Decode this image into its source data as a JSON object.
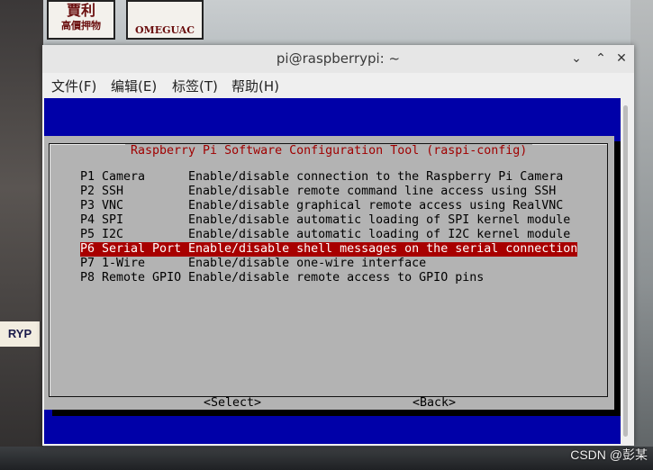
{
  "window": {
    "title": "pi@raspberrypi: ~",
    "controls": {
      "minimize": "⌄",
      "maximize": "⌃",
      "close": "✕"
    }
  },
  "menubar": {
    "items": [
      "文件(F)",
      "编辑(E)",
      "标签(T)",
      "帮助(H)"
    ]
  },
  "dialog": {
    "title": "Raspberry Pi Software Configuration Tool (raspi-config)",
    "selected_index": 5,
    "options": [
      {
        "key": "P1 Camera",
        "desc": "Enable/disable connection to the Raspberry Pi Camera"
      },
      {
        "key": "P2 SSH",
        "desc": "Enable/disable remote command line access using SSH"
      },
      {
        "key": "P3 VNC",
        "desc": "Enable/disable graphical remote access using RealVNC"
      },
      {
        "key": "P4 SPI",
        "desc": "Enable/disable automatic loading of SPI kernel module"
      },
      {
        "key": "P5 I2C",
        "desc": "Enable/disable automatic loading of I2C kernel module"
      },
      {
        "key": "P6 Serial Port",
        "desc": "Enable/disable shell messages on the serial connection"
      },
      {
        "key": "P7 1-Wire",
        "desc": "Enable/disable one-wire interface"
      },
      {
        "key": "P8 Remote GPIO",
        "desc": "Enable/disable remote access to GPIO pins"
      }
    ],
    "buttons": {
      "select": "<Select>",
      "back": "<Back>"
    }
  },
  "background": {
    "sign_1": "賈利",
    "sign_1_sub": "高價押物",
    "sign_2": "OMEGUAC",
    "sign_left": "RYP",
    "watermark": "CSDN @彭某"
  },
  "colors": {
    "terminal_bg": "#0000a8",
    "dialog_bg": "#b3b3b3",
    "title_red": "#a00000",
    "selection": "#a80000"
  }
}
